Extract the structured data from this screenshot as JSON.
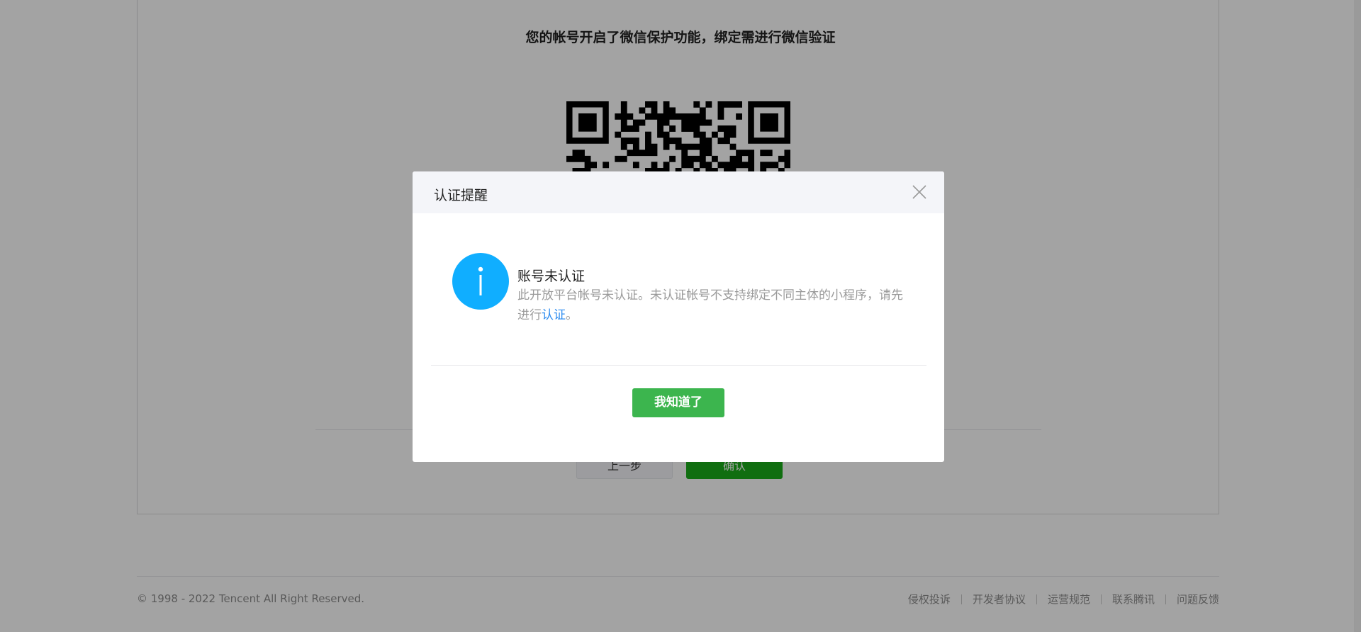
{
  "background": {
    "qr_title": "您的帐号开启了微信保护功能，绑定需进行微信验证",
    "buttons": {
      "prev": "上一步",
      "confirm": "确认"
    },
    "footer": {
      "copyright": "© 1998 - 2022 Tencent All Right Reserved.",
      "links": [
        "侵权投诉",
        "开发者协议",
        "运营规范",
        "联系腾讯",
        "问题反馈"
      ]
    }
  },
  "dialog": {
    "title": "认证提醒",
    "close_icon": "close-icon",
    "info_icon": "info-icon",
    "message_title": "账号未认证",
    "message_text": "此开放平台帐号未认证。未认证帐号不支持绑定不同主体的小程序，请先进行",
    "message_link": "认证",
    "message_end": "。",
    "button": "我知道了"
  },
  "colors": {
    "accent_green": "#3cb54e",
    "info_blue": "#10aeff",
    "link_blue": "#2d8cf0"
  }
}
